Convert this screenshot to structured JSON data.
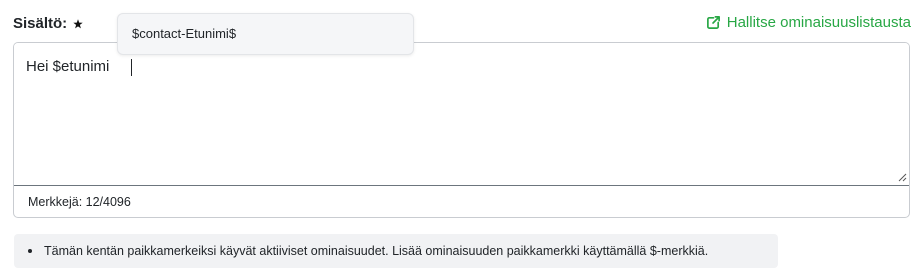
{
  "field": {
    "label": "Sisältö:",
    "required_icon": "star-icon"
  },
  "manage_link": {
    "label": "Hallitse ominaisuuslistausta",
    "icon": "external-link-icon",
    "color": "#28a745"
  },
  "editor": {
    "value": "Hei $etunimi",
    "counter_label": "Merkkejä: 12/4096"
  },
  "suggestions": {
    "items": [
      "$contact-Etunimi$"
    ]
  },
  "help": {
    "items": [
      "Tämän kentän paikkamerkeiksi käyvät aktiiviset ominaisuudet. Lisää ominaisuuden paikkamerkki käyttämällä $-merkkiä."
    ]
  }
}
